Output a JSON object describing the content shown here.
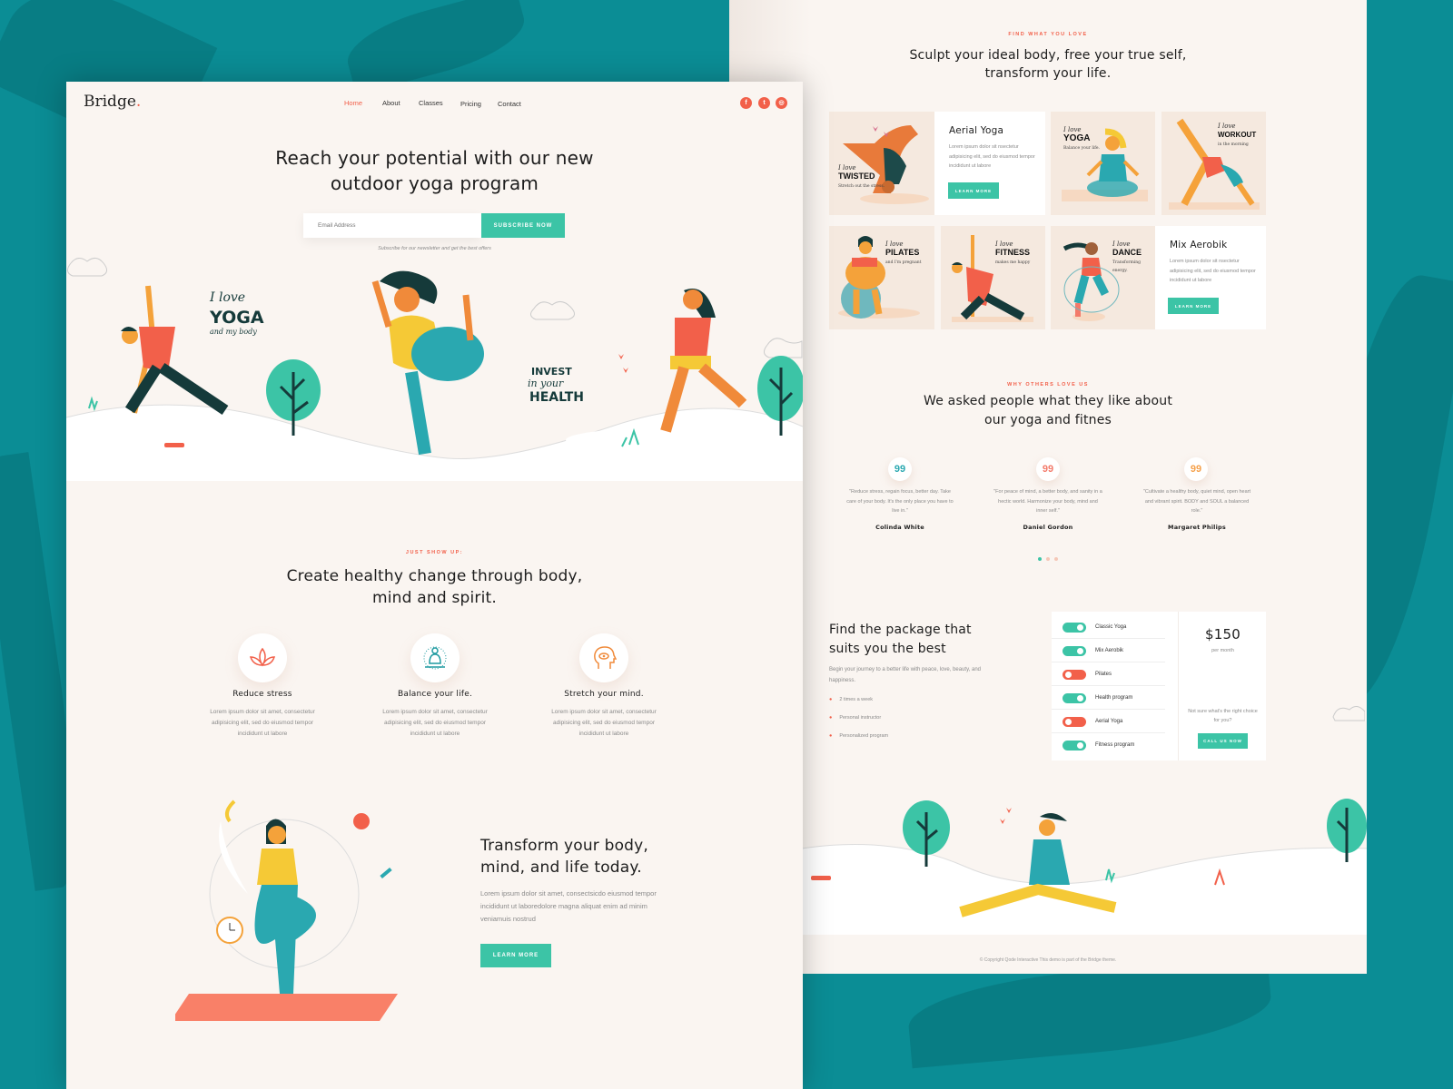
{
  "colors": {
    "accent": "#3cc4a6",
    "coral": "#f2604a",
    "background": "#0b8d95",
    "page": "#faf5f1"
  },
  "home": {
    "logo": "Bridge",
    "logo_dot": ".",
    "nav": [
      {
        "label": "Home",
        "active": true
      },
      {
        "label": "About"
      },
      {
        "label": "Classes"
      },
      {
        "label": "Pricing"
      },
      {
        "label": "Contact"
      }
    ],
    "social": [
      {
        "icon": "facebook-icon",
        "glyph": "f"
      },
      {
        "icon": "twitter-icon",
        "glyph": "t"
      },
      {
        "icon": "instagram-icon",
        "glyph": "◎"
      }
    ],
    "hero": {
      "title_line1": "Reach your potential with our new",
      "title_line2": "outdoor yoga program",
      "email_placeholder": "Email Address",
      "subscribe_label": "SUBSCRIBE NOW",
      "note": "Subscribe for our newsletter and get the best offers"
    },
    "hero_art": {
      "yoga_sign_1": "I love",
      "yoga_sign_2": "YOGA",
      "yoga_sign_3": "and my body",
      "invest_1": "INVEST",
      "invest_2": "in your",
      "invest_3": "HEALTH"
    },
    "features": {
      "eyebrow": "JUST SHOW UP:",
      "title_line1": "Create healthy change through body,",
      "title_line2": "mind and spirit.",
      "items": [
        {
          "icon": "lotus-icon",
          "title": "Reduce stress",
          "text": "Lorem ipsum dolor sit amet, consectetur adipisicing elit, sed do eiusmod tempor incididunt ut labore"
        },
        {
          "icon": "meditation-icon",
          "title": "Balance your life.",
          "text": "Lorem ipsum dolor sit amet, consectetur adipisicing elit, sed do eiusmod tempor incididunt ut labore"
        },
        {
          "icon": "mind-eye-icon",
          "title": "Stretch your mind.",
          "text": "Lorem ipsum dolor sit amet, consectetur adipisicing elit, sed do eiusmod tempor incididunt ut labore"
        }
      ]
    },
    "transform": {
      "title_line1": "Transform your body,",
      "title_line2": "mind, and life today.",
      "text": "Lorem ipsum dolor sit amet, consectsicdo eiusmod tempor incididunt ut laboredolore magna aliquat enim ad minim veniamuis nostrud",
      "button": "LEARN MORE"
    }
  },
  "classes_page": {
    "eyebrow": "FIND WHAT YOU LOVE",
    "title_line1": "Sculpt your ideal body, free your true self,",
    "title_line2": "transform your life.",
    "cards": [
      {
        "script": "I love",
        "name": "TWISTED",
        "sub": "Stretch out the stress."
      },
      {
        "script": "I love",
        "name": "YOGA",
        "sub": "Balance your life."
      },
      {
        "script": "I love",
        "name": "WORKOUT",
        "sub": "in the morning"
      },
      {
        "script": "I love",
        "name": "PILATES",
        "sub": "and I'm pregnant"
      },
      {
        "script": "I love",
        "name": "FITNESS",
        "sub": "makes me happy"
      },
      {
        "script": "I love",
        "name": "DANCE",
        "sub": "Transforming energy."
      }
    ],
    "text_cards": [
      {
        "title": "Aerial Yoga",
        "text": "Lorem ipsum dolor sit nsectetur adipisicing elit, sed do eiusmod tempor incididunt ut labore",
        "button": "LEARN MORE"
      },
      {
        "title": "Mix Aerobik",
        "text": "Lorem ipsum dolor sit nsectetur adipisicing elit, sed do eiusmod tempor incididunt ut labore",
        "button": "LEARN MORE"
      }
    ],
    "testimonials": {
      "eyebrow": "WHY OTHERS LOVE US",
      "title_line1": "We asked people what they like about",
      "title_line2": "our yoga and fitnes",
      "items": [
        {
          "quote": "\"Reduce stress, regain focus, better day. Take care of your body. It's the only place you have to live in.\"",
          "name": "Colinda White",
          "color": "#2aa8b0"
        },
        {
          "quote": "\"For peace of mind, a better body, and sanity in a hectic world. Harmonize your body, mind and inner self.\"",
          "name": "Daniel Gordon",
          "color": "#f37a6a"
        },
        {
          "quote": "\"Cultivate a healthy body, quiet mind, open heart and vibrant spirit. BODY and SOUL a balanced role.\"",
          "name": "Margaret Philips",
          "color": "#f5a04a"
        }
      ],
      "quote_glyph": "99",
      "active_dot": 1,
      "dot_count": 3
    },
    "pricing": {
      "title_line1": "Find the package that",
      "title_line2": "suits you the best",
      "text": "Begin your journey to a better life with peace, love, beauty, and happiness.",
      "bullets": [
        "2 times a week",
        "Personal instructor",
        "Personalized program"
      ],
      "options": [
        {
          "label": "Classic Yoga",
          "on": true
        },
        {
          "label": "Mix Aerobik",
          "on": true
        },
        {
          "label": "Pilates",
          "on": false
        },
        {
          "label": "Health program",
          "on": true
        },
        {
          "label": "Aerial Yoga",
          "on": false
        },
        {
          "label": "Fitness program",
          "on": true
        }
      ],
      "price": "$150",
      "period": "per month",
      "help": "Not sure what's the right choice for you?",
      "button": "CALL US NOW"
    },
    "footer": "© Copyright Qode Interactive This demo is part of the Bridge theme."
  }
}
